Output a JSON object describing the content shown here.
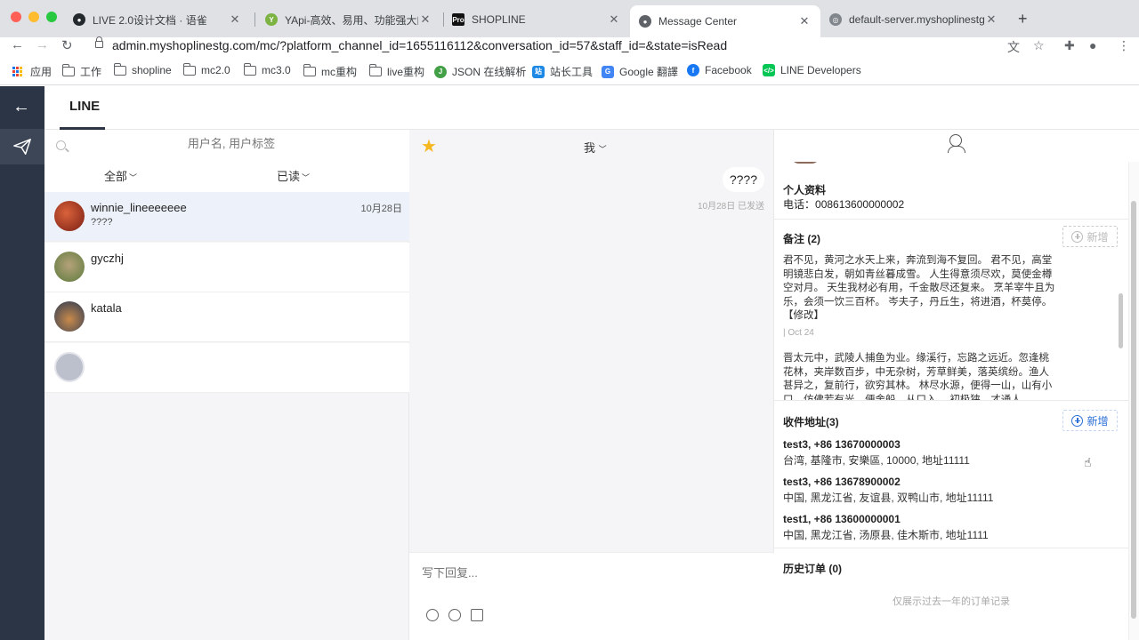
{
  "browser": {
    "tabs": [
      {
        "title": "LIVE 2.0设计文档 · 语雀",
        "active": false
      },
      {
        "title": "YApi-高效、易用、功能强大的可",
        "active": false
      },
      {
        "title": "SHOPLINE",
        "active": false
      },
      {
        "title": "Message Center",
        "active": true
      },
      {
        "title": "default-server.myshoplinestg.c",
        "active": false
      }
    ],
    "url": "admin.myshoplinestg.com/mc/?platform_channel_id=1655116112&conversation_id=57&staff_id=&state=isRead",
    "bookmarks": [
      "应用",
      "工作",
      "shopline",
      "mc2.0",
      "mc3.0",
      "mc重构",
      "live重构",
      "JSON 在线解析",
      "站长工具",
      "Google 翻譯",
      "Facebook",
      "LINE Developers"
    ]
  },
  "app": {
    "channel_tab": "LINE",
    "search_placeholder": "用户名, 用户标签",
    "filters": {
      "all": "全部",
      "state": "已读"
    },
    "conversations": [
      {
        "name": "winnie_lineeeeeee",
        "preview": "????",
        "date": "10月28日"
      },
      {
        "name": "gyczhj",
        "preview": "",
        "date": ""
      },
      {
        "name": "katala",
        "preview": "",
        "date": ""
      },
      {
        "name": "",
        "preview": "",
        "date": ""
      }
    ],
    "chat": {
      "agent": "我",
      "message": "????",
      "message_date": "10月28日",
      "message_status": "已发送",
      "composer_placeholder": "写下回复..."
    },
    "profile": {
      "title": "个人资料",
      "phone_label": "电话：",
      "phone": "008613600000002"
    },
    "notes": {
      "title": "备注 (2)",
      "add_label": "新增",
      "items": [
        {
          "text": "君不见，黄河之水天上来，奔流到海不复回。 君不见，高堂明镜悲白发，朝如青丝暮成雪。 人生得意须尽欢，莫使金樽空对月。 天生我材必有用，千金散尽还复来。 烹羊宰牛且为乐，会须一饮三百杯。 岑夫子，丹丘生，将进酒，杯莫停。 【修改】",
          "date": "| Oct 24"
        },
        {
          "text": "晋太元中，武陵人捕鱼为业。缘溪行，忘路之远近。忽逢桃花林，夹岸数百步，中无杂树，芳草鲜美，落英缤纷。渔人甚异之，复前行，欲穷其林。 林尽水源，便得一山，山有小口，仿佛若有光。便舍船，从口入。 初极狭，才通人",
          "date": ""
        }
      ]
    },
    "addresses": {
      "title": "收件地址(3)",
      "add_label": "新增",
      "items": [
        {
          "name": "test3, +86 13670000003",
          "line": "台湾, 基隆市, 安樂區, 10000, 地址11111"
        },
        {
          "name": "test3, +86 13678900002",
          "line": "中国, 黑龙江省, 友谊县, 双鸭山市, 地址11111"
        },
        {
          "name": "test1, +86 13600000001",
          "line": "中国, 黑龙江省, 汤原县, 佳木斯市, 地址1111"
        }
      ]
    },
    "orders": {
      "title": "历史订单 (0)",
      "hint": "仅展示过去一年的订单记录"
    }
  }
}
